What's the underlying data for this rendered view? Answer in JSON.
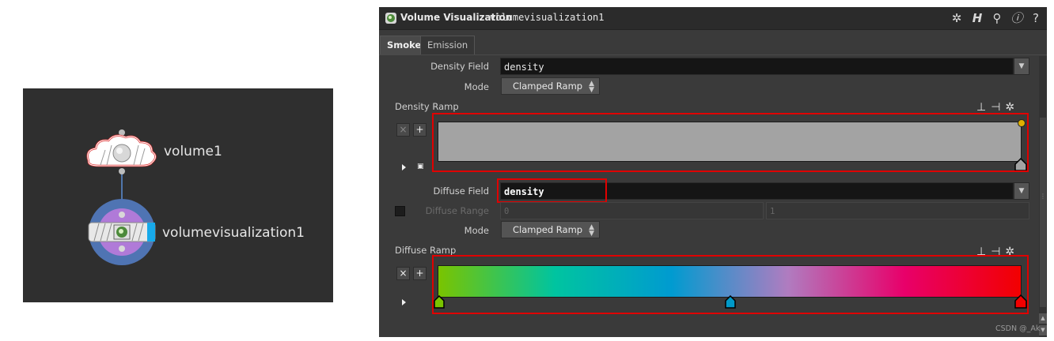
{
  "network": {
    "nodes": [
      {
        "name": "volume1",
        "icon": "cloud-volume-icon"
      },
      {
        "name": "volumevisualization1",
        "icon": "volume-visualization-icon"
      }
    ]
  },
  "pane": {
    "node_type": "Volume Visualization",
    "node_name": "volumevisualization1",
    "toolbar_icons": [
      "gear-icon",
      "help-h-icon",
      "search-icon",
      "info-icon",
      "question-icon"
    ],
    "tabs": [
      {
        "label": "Smoke",
        "active": true
      },
      {
        "label": "Emission",
        "active": false
      }
    ],
    "density_field": {
      "label": "Density Field",
      "value": "density"
    },
    "density_mode": {
      "label": "Mode",
      "value": "Clamped Ramp"
    },
    "density_ramp": {
      "label": "Density Ramp",
      "color": "#a3a3a3"
    },
    "diffuse_field": {
      "label": "Diffuse Field",
      "value": "density"
    },
    "diffuse_range": {
      "label": "Diffuse Range",
      "min": "0",
      "max": "1",
      "enabled": false
    },
    "diffuse_mode": {
      "label": "Mode",
      "value": "Clamped Ramp"
    },
    "diffuse_ramp": {
      "label": "Diffuse Ramp",
      "stops": [
        "#7ac400",
        "#00c4a0",
        "#009bd0",
        "#b07cc0",
        "#e8006a",
        "#f20000"
      ],
      "key_colors": [
        "#7ac400",
        "#0099c8",
        "#f20000"
      ]
    }
  },
  "watermark": "CSDN @_Ak",
  "colors": {
    "highlight": "#e00000",
    "pane_bg": "#3a3a3a",
    "network_bg": "#2f2f2f"
  }
}
